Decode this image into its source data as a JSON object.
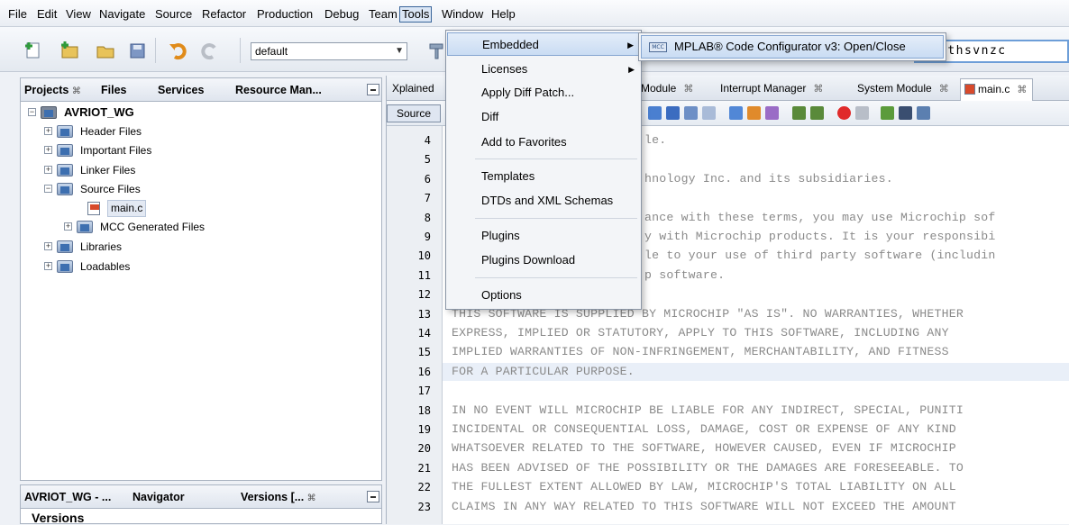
{
  "menubar": {
    "items": [
      "File",
      "Edit",
      "View",
      "Navigate",
      "Source",
      "Refactor",
      "Production",
      "Debug",
      "Team",
      "Tools",
      "Window",
      "Help"
    ]
  },
  "toolbar": {
    "config_combo": "default",
    "search_fragment": "0",
    "search_value": "ithsvnzc"
  },
  "projects_panel": {
    "tabs": [
      "Projects",
      "Files",
      "Services",
      "Resource Man..."
    ],
    "project": "AVRIOT_WG",
    "tree": [
      "Header Files",
      "Important Files",
      "Linker Files",
      "Source Files",
      "main.c",
      "MCC Generated Files",
      "Libraries",
      "Loadables"
    ]
  },
  "bottom_panel": {
    "tabs": [
      "AVRIOT_WG - ...",
      "Navigator",
      "Versions [..."
    ],
    "content_title": "Versions"
  },
  "editor": {
    "tabs": [
      "Xplained",
      "Module",
      "Interrupt Manager",
      "System Module",
      "main.c"
    ],
    "source_tab": "Source",
    "line_numbers": [
      "4",
      "5",
      "6",
      "7",
      "8",
      "9",
      "10",
      "11",
      "12",
      "13",
      "14",
      "15",
      "16",
      "17",
      "18",
      "19",
      "20",
      "21",
      "22",
      "23"
    ],
    "visible_fragments": [
      "le.",
      "",
      "hnology Inc. and its subsidiaries.",
      "",
      "ance with these terms, you may use Microchip sof",
      "y with Microchip products. It is your responsibi",
      "le to your use of third party software (includin",
      "p software."
    ],
    "full_lines": [
      "THIS SOFTWARE IS SUPPLIED BY MICROCHIP \"AS IS\". NO WARRANTIES, WHETHER",
      "EXPRESS, IMPLIED OR STATUTORY, APPLY TO THIS SOFTWARE, INCLUDING ANY",
      "IMPLIED WARRANTIES OF NON-INFRINGEMENT, MERCHANTABILITY, AND FITNESS",
      "FOR A PARTICULAR PURPOSE.",
      "",
      "IN NO EVENT WILL MICROCHIP BE LIABLE FOR ANY INDIRECT, SPECIAL, PUNITI",
      "INCIDENTAL OR CONSEQUENTIAL LOSS, DAMAGE, COST OR EXPENSE OF ANY KIND",
      "WHATSOEVER RELATED TO THE SOFTWARE, HOWEVER CAUSED, EVEN IF MICROCHIP",
      "HAS BEEN ADVISED OF THE POSSIBILITY OR THE DAMAGES ARE FORESEEABLE. TO",
      "THE FULLEST EXTENT ALLOWED BY LAW, MICROCHIP'S TOTAL LIABILITY ON ALL",
      "CLAIMS IN ANY WAY RELATED TO THIS SOFTWARE WILL NOT EXCEED THE AMOUNT"
    ]
  },
  "tools_menu": {
    "items": [
      "Embedded",
      "Licenses",
      "Apply Diff Patch...",
      "Diff",
      "Add to Favorites",
      "Templates",
      "DTDs and XML Schemas",
      "Plugins",
      "Plugins Download",
      "Options"
    ]
  },
  "embedded_submenu": {
    "item": "MPLAB® Code Configurator v3: Open/Close",
    "icon_text": "MCC"
  }
}
